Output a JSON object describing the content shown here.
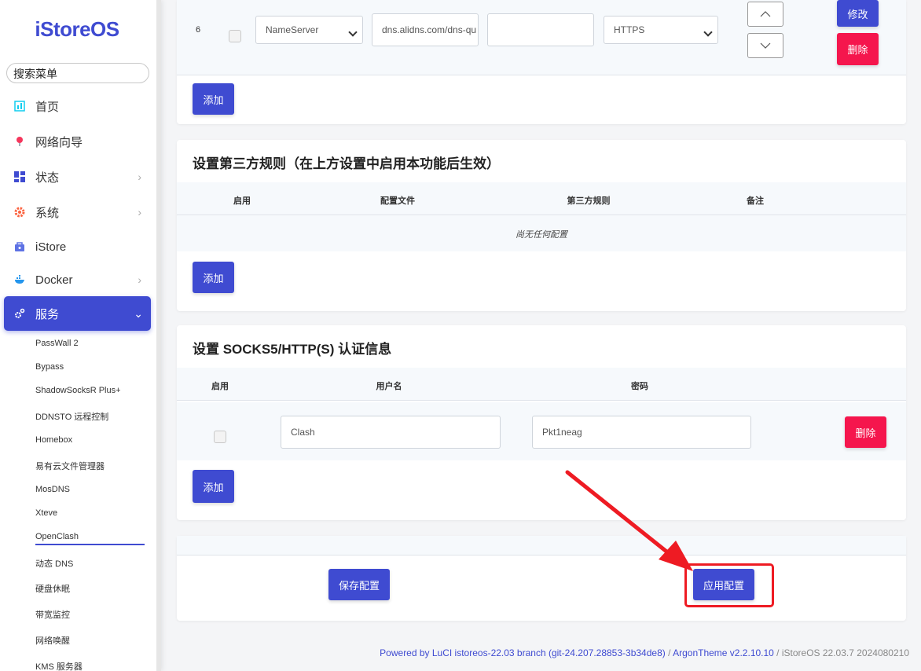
{
  "sidebar": {
    "logo": "iStoreOS",
    "search_placeholder": "搜索菜单",
    "items": [
      {
        "label": "首页"
      },
      {
        "label": "网络向导"
      },
      {
        "label": "状态"
      },
      {
        "label": "系统"
      },
      {
        "label": "iStore"
      },
      {
        "label": "Docker"
      },
      {
        "label": "服务"
      }
    ],
    "sub_items": [
      "PassWall 2",
      "Bypass",
      "ShadowSocksR Plus+",
      "DDNSTO 远程控制",
      "Homebox",
      "易有云文件管理器",
      "MosDNS",
      "Xteve",
      "OpenClash",
      "动态 DNS",
      "硬盘休眠",
      "带宽监控",
      "网络唤醒",
      "KMS 服务器"
    ]
  },
  "dns_row": {
    "index": "6",
    "group_value": "NameServer",
    "address_value": "dns.alidns.com/dns-qu",
    "port_value": "",
    "type_value": "HTTPS",
    "modify_label": "修改",
    "delete_label": "删除"
  },
  "add_label": "添加",
  "third_party": {
    "title": "设置第三方规则（在上方设置中启用本功能后生效）",
    "headers": [
      "启用",
      "配置文件",
      "第三方规则",
      "备注"
    ],
    "empty_text": "尚无任何配置"
  },
  "auth": {
    "title": "设置 SOCKS5/HTTP(S) 认证信息",
    "headers": [
      "启用",
      "用户名",
      "密码"
    ],
    "username": "Clash",
    "password": "Pkt1neag",
    "delete_label": "删除"
  },
  "actions": {
    "save_label": "保存配置",
    "apply_label": "应用配置"
  },
  "footer": {
    "luci": "Powered by LuCI istoreos-22.03 branch (git-24.207.28853-3b34de8)",
    "sep1": " / ",
    "theme": "ArgonTheme v2.2.10.10",
    "sep2": " / ",
    "os": "iStoreOS 22.03.7 2024080210"
  },
  "colors": {
    "accent": "#3f4bd1",
    "danger": "#f5164d",
    "annotation": "#ee1b23"
  }
}
